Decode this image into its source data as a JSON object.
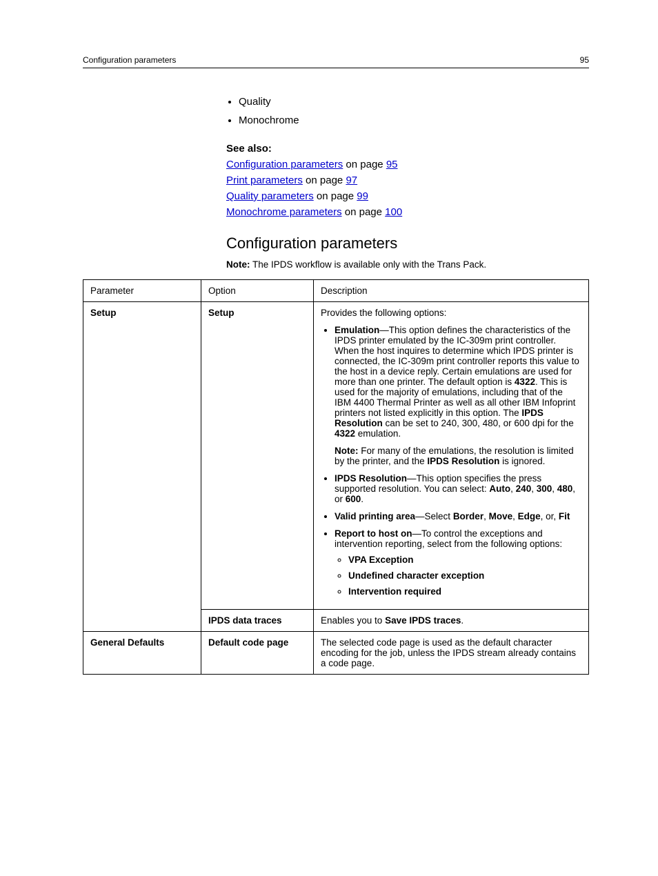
{
  "header": {
    "left": "Configuration parameters",
    "right": "95"
  },
  "top_bullets": [
    "Quality",
    "Monochrome"
  ],
  "see_also": {
    "title": "See also:",
    "items": [
      {
        "link": "Configuration parameters",
        "mid": " on page ",
        "page": "95"
      },
      {
        "link": "Print parameters",
        "mid": " on page ",
        "page": "97"
      },
      {
        "link": "Quality parameters",
        "mid": " on page ",
        "page": "99"
      },
      {
        "link": "Monochrome parameters",
        "mid": " on page ",
        "page": "100"
      }
    ]
  },
  "section_heading": "Configuration parameters",
  "note": {
    "label": "Note:",
    "text": " The IPDS workflow is available only with the Trans Pack."
  },
  "table": {
    "headers": {
      "c1": "Parameter",
      "c2": "Option",
      "c3": "Description"
    },
    "rows": [
      {
        "param": "Setup",
        "option": "Setup",
        "desc": {
          "intro": "Provides the following options:",
          "emulation": {
            "label": "Emulation",
            "text_a": "—This option defines the characteristics of the IPDS printer emulated by the IC-309m print controller. When the host inquires to determine which IPDS printer is connected, the IC-309m print controller reports this value to the host in a device reply. Certain emulations are used for more than one printer. The default option is ",
            "b1": "4322",
            "text_b": ". This is used for the majority of emulations, including that of the IBM 4400 Thermal Printer as well as all other IBM Infoprint printers not listed explicitly in this option. The ",
            "b2": "IPDS Resolution",
            "text_c": " can be set to 240, 300, 480, or 600 dpi for the ",
            "b3": "4322",
            "text_d": " emulation."
          },
          "note": {
            "label": "Note:",
            "text_a": " For many of the emulations, the resolution is limited by the printer, and the ",
            "b1": "IPDS Resolution",
            "text_b": " is ignored."
          },
          "ipds_res": {
            "label": "IPDS Resolution",
            "text_a": "—This option specifies the press supported resolution. You can select: ",
            "b1": "Auto",
            "sep1": ", ",
            "b2": "240",
            "sep2": ", ",
            "b3": "300",
            "sep3": ", ",
            "b4": "480",
            "sep4": ", or ",
            "b5": "600",
            "tail": "."
          },
          "vpa": {
            "label": "Valid printing area",
            "mid": "—Select ",
            "b1": "Border",
            "s1": ", ",
            "b2": "Move",
            "s2": ", ",
            "b3": "Edge",
            "s3": ", or, ",
            "b4": "Fit"
          },
          "report": {
            "label": "Report to host on",
            "text": "—To control the exceptions and intervention reporting, select from the following options:",
            "sub": [
              "VPA Exception",
              "Undefined character exception",
              "Intervention required"
            ]
          }
        }
      },
      {
        "param": "",
        "option": "IPDS data traces",
        "desc": {
          "pre": "Enables you to ",
          "bold": "Save IPDS traces",
          "post": "."
        }
      },
      {
        "param": "General Defaults",
        "option": "Default code page",
        "desc": {
          "text": "The selected code page is used as the default character encoding for the job, unless the IPDS stream already contains a code page."
        }
      }
    ]
  }
}
